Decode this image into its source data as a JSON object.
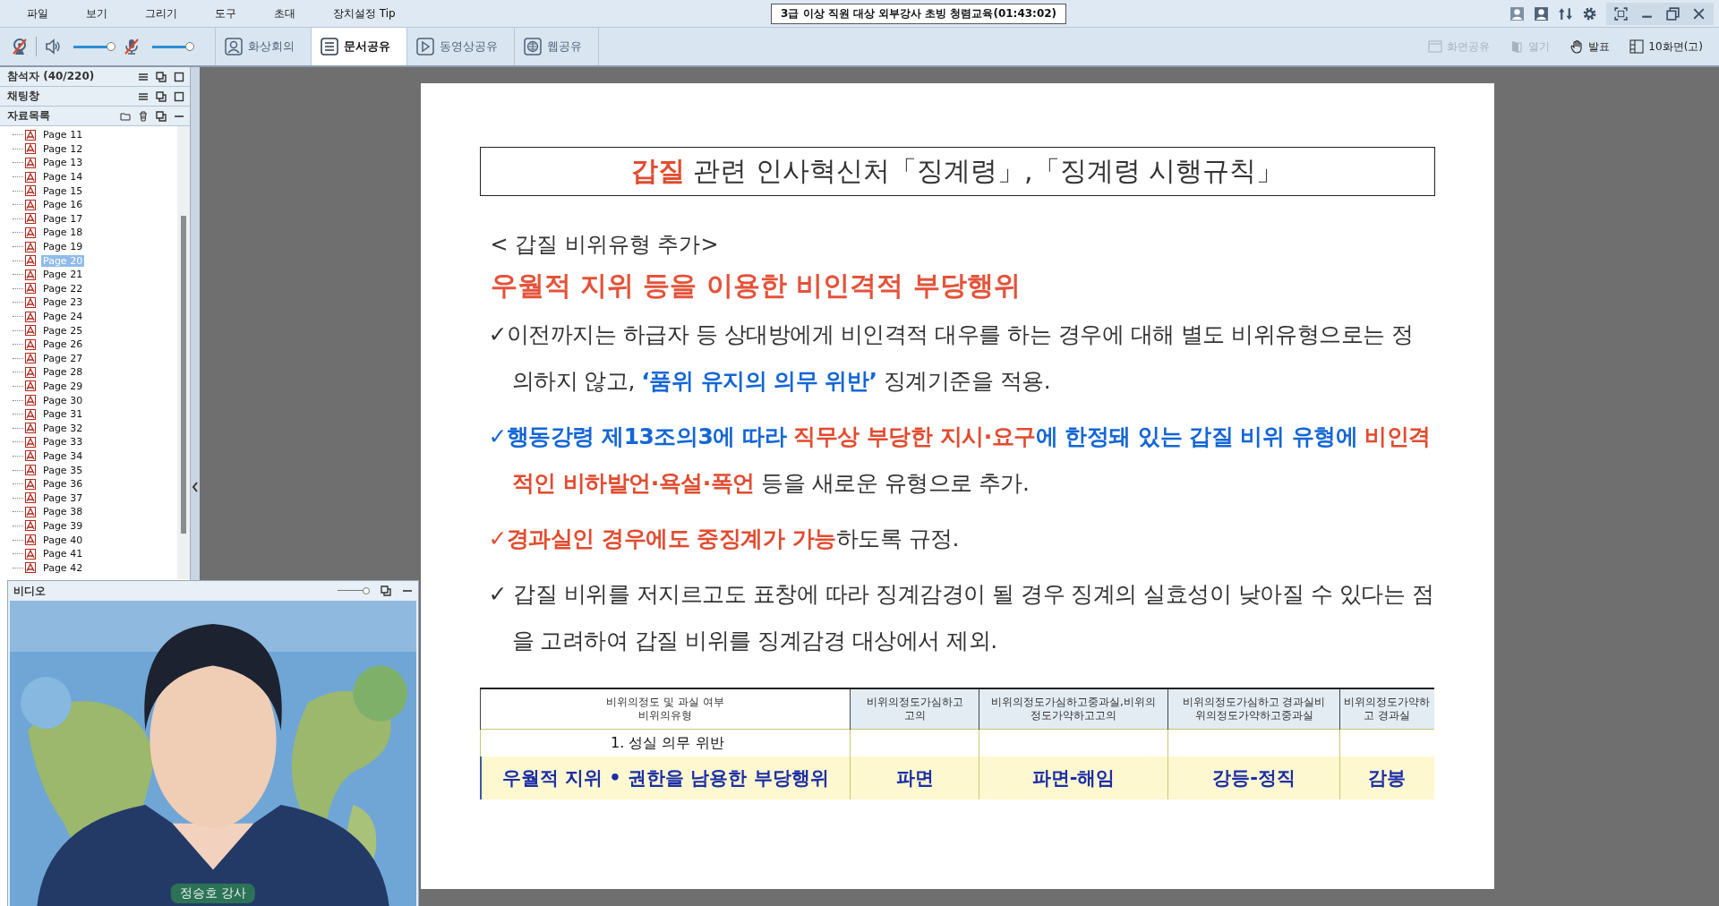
{
  "menu": [
    "파일",
    "보기",
    "그리기",
    "도구",
    "초대",
    "장치설정 Tip"
  ],
  "session_title": "3급 이상 직원 대상 외부강사 초빙 청렴교육(01:43:02)",
  "audio": {
    "camera_muted": true,
    "speaker_volume": {
      "level": 1
    },
    "mic_muted": true,
    "mic_volume": {
      "level": 1
    }
  },
  "tabs": [
    {
      "label": "화상회의",
      "kind": "person",
      "selected": false
    },
    {
      "label": "문서공유",
      "kind": "document",
      "selected": true
    },
    {
      "label": "동영상공유",
      "kind": "play",
      "selected": false
    },
    {
      "label": "웹공유",
      "kind": "globe",
      "selected": false
    }
  ],
  "actions": [
    {
      "label": "화면공유",
      "kind": "window",
      "disabled": true
    },
    {
      "label": "열기",
      "kind": "door",
      "disabled": true
    },
    {
      "label": "발표",
      "kind": "hand",
      "disabled": false
    },
    {
      "label": "10화면(고)",
      "kind": "grid",
      "disabled": false
    }
  ],
  "sidebar": {
    "sections": [
      {
        "title": "참석자 (40/220)",
        "kind": "panel"
      },
      {
        "title": "채팅창",
        "kind": "panel"
      },
      {
        "title": "자료목록",
        "kind": "files"
      }
    ],
    "pages": [
      {
        "label": "Page 11",
        "selected": false
      },
      {
        "label": "Page 12",
        "selected": false
      },
      {
        "label": "Page 13",
        "selected": false
      },
      {
        "label": "Page 14",
        "selected": false
      },
      {
        "label": "Page 15",
        "selected": false
      },
      {
        "label": "Page 16",
        "selected": false
      },
      {
        "label": "Page 17",
        "selected": false
      },
      {
        "label": "Page 18",
        "selected": false
      },
      {
        "label": "Page 19",
        "selected": false
      },
      {
        "label": "Page 20",
        "selected": true
      },
      {
        "label": "Page 21",
        "selected": false
      },
      {
        "label": "Page 22",
        "selected": false
      },
      {
        "label": "Page 23",
        "selected": false
      },
      {
        "label": "Page 24",
        "selected": false
      },
      {
        "label": "Page 25",
        "selected": false
      },
      {
        "label": "Page 26",
        "selected": false
      },
      {
        "label": "Page 27",
        "selected": false
      },
      {
        "label": "Page 28",
        "selected": false
      },
      {
        "label": "Page 29",
        "selected": false
      },
      {
        "label": "Page 30",
        "selected": false
      },
      {
        "label": "Page 31",
        "selected": false
      },
      {
        "label": "Page 32",
        "selected": false
      },
      {
        "label": "Page 33",
        "selected": false
      },
      {
        "label": "Page 34",
        "selected": false
      },
      {
        "label": "Page 35",
        "selected": false
      },
      {
        "label": "Page 36",
        "selected": false
      },
      {
        "label": "Page 37",
        "selected": false
      },
      {
        "label": "Page 38",
        "selected": false
      },
      {
        "label": "Page 39",
        "selected": false
      },
      {
        "label": "Page 40",
        "selected": false
      },
      {
        "label": "Page 41",
        "selected": false
      },
      {
        "label": "Page 42",
        "selected": false
      }
    ]
  },
  "video": {
    "title": "비디오",
    "zoom": {
      "level": 1
    },
    "speaker": "정승호 강사"
  },
  "slide": {
    "title": [
      {
        "text": "갑질",
        "kind": "red"
      },
      {
        "text": " 관련 인사혁신처「징계령」,「징계령 시행규칙」",
        "kind": "plain"
      }
    ],
    "subtitle": "< 갑질 비위유형 추가>",
    "heading": "우월적 지위 등을 이용한 비인격적 부당행위",
    "paragraphs": [
      [
        {
          "text": "✓",
          "kind": "plain"
        },
        {
          "text": "이전까지는 하급자 등 상대방에게 비인격적 대우를 하는 경우에 대해 별도 비위유형으로는 정의하지 않고, ",
          "kind": "plain"
        },
        {
          "text": "‘품위 유지의 의무 위반’",
          "kind": "blue"
        },
        {
          "text": " 징계기준을 적용.",
          "kind": "plain"
        }
      ],
      [
        {
          "text": "✓",
          "kind": "blue"
        },
        {
          "text": "행동강령 제13조의3에 따라 ",
          "kind": "blue"
        },
        {
          "text": "직무상 부당한 지시·요구",
          "kind": "red"
        },
        {
          "text": "에 한정돼 있는 갑질 비위 유형에 ",
          "kind": "blue"
        },
        {
          "text": "비인격적인 비하발언·욕설·폭언",
          "kind": "red"
        },
        {
          "text": " 등을 새로운 유형으로 추가.",
          "kind": "plain"
        }
      ],
      [
        {
          "text": "✓",
          "kind": "red"
        },
        {
          "text": "경과실인 경우에도 중징계가 가능",
          "kind": "red"
        },
        {
          "text": "하도록 규정.",
          "kind": "plain"
        }
      ],
      [
        {
          "text": "✓",
          "kind": "plain"
        },
        {
          "text": " 갑질 비위를 저지르고도 표창에 따라 징계감경이 될 경우 징계의 실효성이 낮아질 수 있다는 점을 고려하여 갑질 비위를 징계감경 대상에서 제외.",
          "kind": "plain"
        }
      ]
    ],
    "table": {
      "columns": [
        [
          "비위의정도 및 과실 여부",
          "비위의유형"
        ],
        [
          "비위의정도가심하고",
          "고의"
        ],
        [
          "비위의정도가심하고중과실,비위의",
          "정도가약하고고의"
        ],
        [
          "비위의정도가심하고 경과실비",
          "위의정도가약하고중과실"
        ],
        [
          "비위의정도가약하",
          "고 경과실"
        ]
      ],
      "section": "1. 성실 의무 위반",
      "row": [
        "우월적 지위 • 권한을  남용한 부당행위",
        "파면",
        "파면-해임",
        "강등-정직",
        "감봉"
      ]
    }
  }
}
